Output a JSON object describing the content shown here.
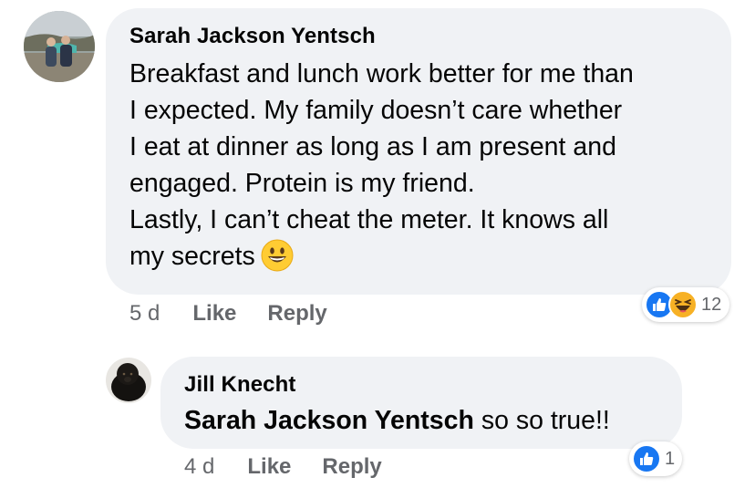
{
  "comments": [
    {
      "author": "Sarah Jackson Yentsch",
      "text": "Breakfast and lunch work better for me than\nI expected.  My family doesn’t care whether\nI eat at dinner as long as I am present and\nengaged.  Protein is my friend.\nLastly, I can’t cheat the meter.  It knows all\nmy secrets",
      "emoji": "grinning-face-emoji",
      "time": "5 d",
      "like_label": "Like",
      "reply_label": "Reply",
      "reactions": [
        "like-icon",
        "haha-icon"
      ],
      "reaction_count": "12"
    },
    {
      "author": "Jill Knecht",
      "mention": "Sarah Jackson Yentsch",
      "text": "so so true!!",
      "time": "4 d",
      "like_label": "Like",
      "reply_label": "Reply",
      "reactions": [
        "like-icon"
      ],
      "reaction_count": "1"
    }
  ],
  "colors": {
    "bubble": "#f0f2f5",
    "meta": "#65676b",
    "like_blue": "#1877f2",
    "haha_yellow": "#f7b125"
  }
}
